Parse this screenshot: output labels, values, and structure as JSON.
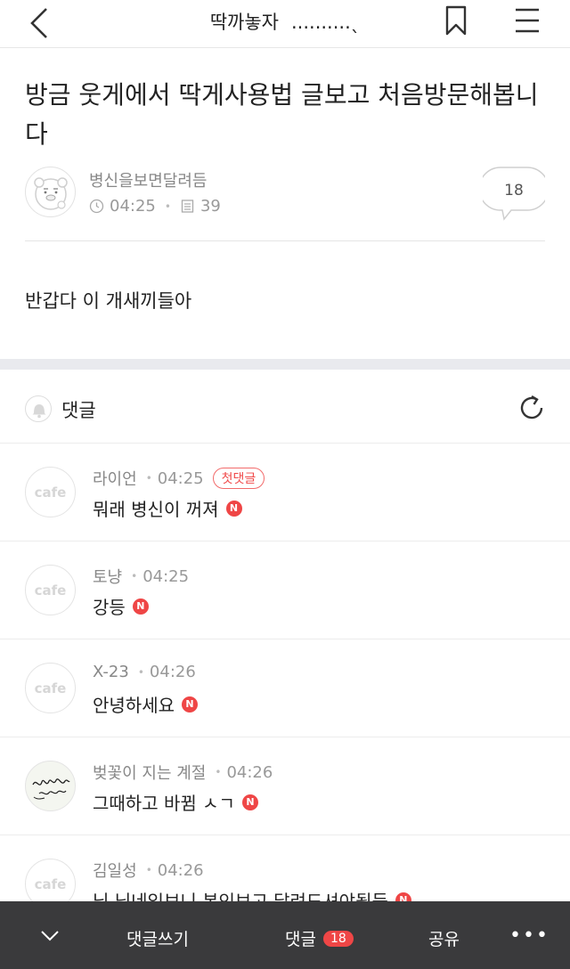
{
  "topbar": {
    "title": "딱까놓자",
    "dots": "..........ˎ",
    "back_icon": "chevron-left-icon",
    "bookmark_icon": "bookmark-icon",
    "menu_icon": "hamburger-menu-icon"
  },
  "article": {
    "title": "방금 웃게에서 딱게사용법 글보고 처음방문해봅니다",
    "author": "병신을보면달려듬",
    "time": "04:25",
    "views": "39",
    "comment_count": "18",
    "body": "반갑다 이 개새끼들아"
  },
  "comments_section": {
    "label": "댓글"
  },
  "comments": [
    {
      "author": "라이언",
      "time": "04:25",
      "badge": "첫댓글",
      "text": "뭐래 병신이 꺼져",
      "avatar": "cafe",
      "new": "N"
    },
    {
      "author": "토냥",
      "time": "04:25",
      "text": "강등",
      "avatar": "cafe",
      "new": "N"
    },
    {
      "author": "X-23",
      "time": "04:26",
      "text": "안녕하세요",
      "avatar": "cafe",
      "new": "N"
    },
    {
      "author": "벚꽃이 지는 계절",
      "time": "04:26",
      "text": "그때하고 바뀜 ㅅㄱ",
      "avatar": "",
      "new": "N"
    },
    {
      "author": "김일성",
      "time": "04:26",
      "text": "님 닉네임보니 본인보고 달려드셔야될듯",
      "avatar": "cafe",
      "new": "N"
    }
  ],
  "bottombar": {
    "write": "댓글쓰기",
    "comments": "댓글",
    "comments_count": "18",
    "share": "공유",
    "more": "•••"
  },
  "colors": {
    "accent_red": "#ef4646",
    "bottom_bar": "#3a3a3c"
  }
}
